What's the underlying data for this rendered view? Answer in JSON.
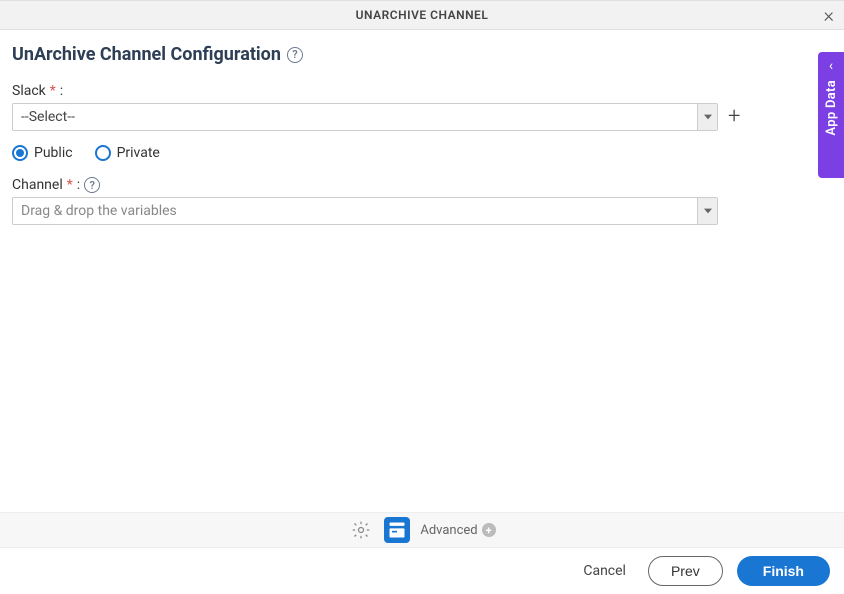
{
  "header": {
    "title": "UNARCHIVE CHANNEL"
  },
  "section": {
    "title": "UnArchive Channel Configuration"
  },
  "fields": {
    "slack": {
      "label": "Slack",
      "required_colon": ":",
      "select_value": "--Select--"
    },
    "visibility": {
      "public": "Public",
      "private": "Private"
    },
    "channel": {
      "label": "Channel",
      "required_colon": ":",
      "placeholder": "Drag & drop the variables"
    }
  },
  "side_tab": {
    "label": "App Data"
  },
  "toolbar": {
    "advanced": "Advanced"
  },
  "footer": {
    "cancel": "Cancel",
    "prev": "Prev",
    "finish": "Finish"
  }
}
